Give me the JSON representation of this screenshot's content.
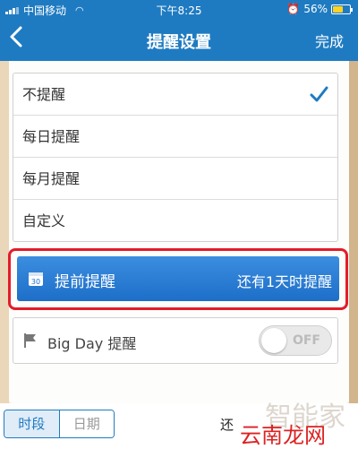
{
  "status_bar": {
    "carrier": "中国移动",
    "time": "下午8:25",
    "battery_percent": "56%",
    "battery_level": 0.56
  },
  "nav": {
    "back_icon": "chevron-left-icon",
    "title": "提醒设置",
    "done_label": "完成"
  },
  "reminder_options": [
    {
      "label": "不提醒",
      "selected": true
    },
    {
      "label": "每日提醒",
      "selected": false
    },
    {
      "label": "每月提醒",
      "selected": false
    },
    {
      "label": "自定义",
      "selected": false
    }
  ],
  "advance_reminder": {
    "label": "提前提醒",
    "value": "还有1天时提醒",
    "icon": "calendar-icon",
    "calendar_day": "30"
  },
  "big_day": {
    "label": "Big Day 提醒",
    "icon": "flag-icon",
    "toggle_text": "OFF",
    "toggle_on": false
  },
  "bottom": {
    "segment_time": "时段",
    "segment_date": "日期",
    "still_text": "还",
    "watermark": "云南龙网",
    "watermark_faint": "智能家"
  },
  "colors": {
    "nav": "#1f7bc1",
    "accent": "#1f7bc1",
    "highlight_border": "#e41b2a"
  }
}
